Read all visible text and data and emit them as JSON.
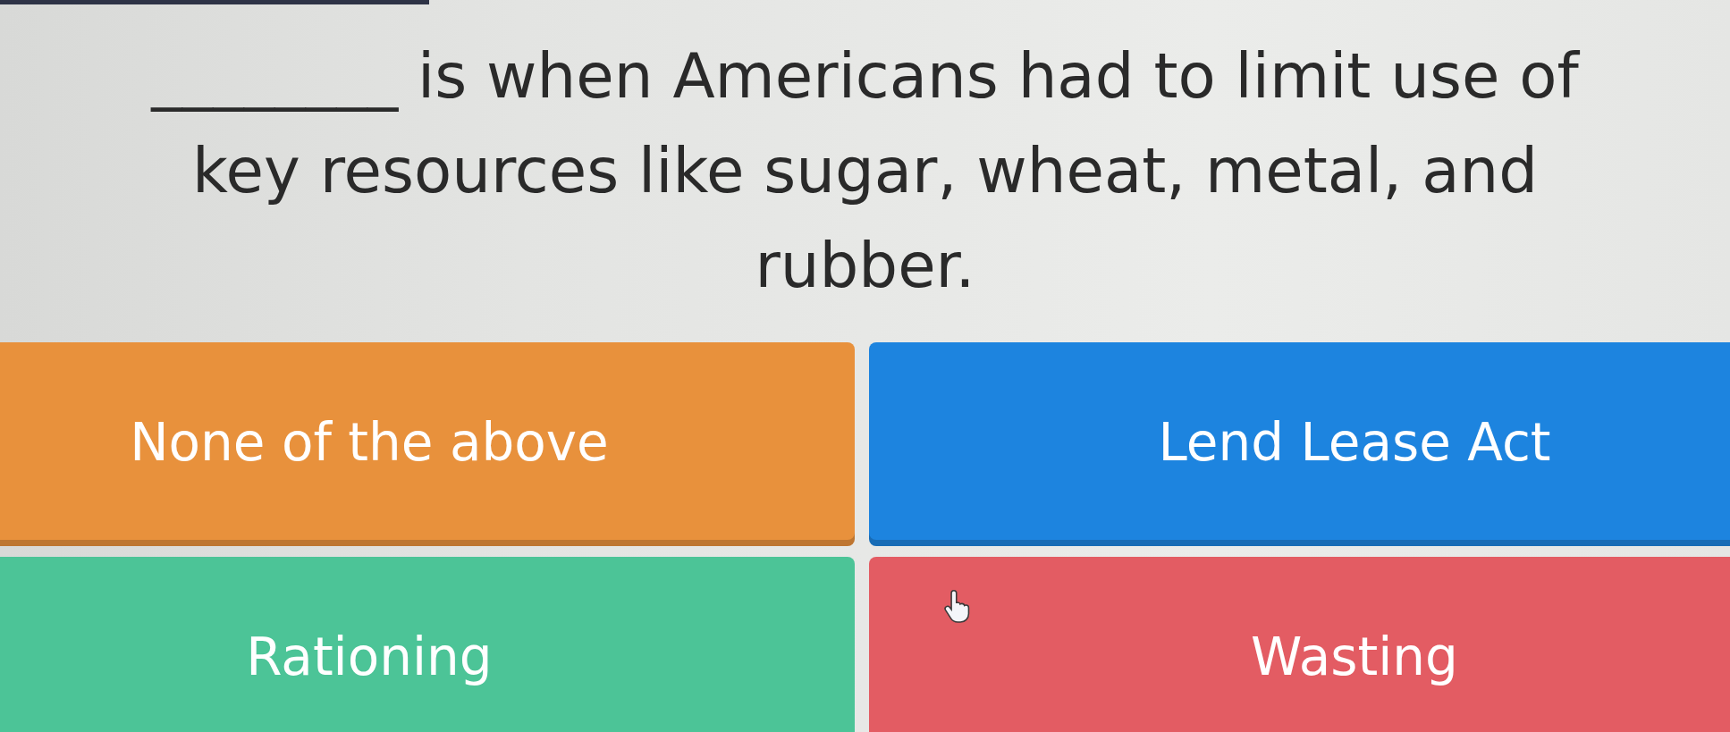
{
  "question": {
    "text": "________ is when Americans had to limit use of key resources like sugar, wheat, metal, and rubber."
  },
  "answers": [
    {
      "text": "None of the above",
      "color": "#e8913c"
    },
    {
      "text": "Lend Lease Act",
      "color": "#1d84df"
    },
    {
      "text": "Rationing",
      "color": "#4cc497"
    },
    {
      "text": "Wasting",
      "color": "#e35c63"
    }
  ]
}
